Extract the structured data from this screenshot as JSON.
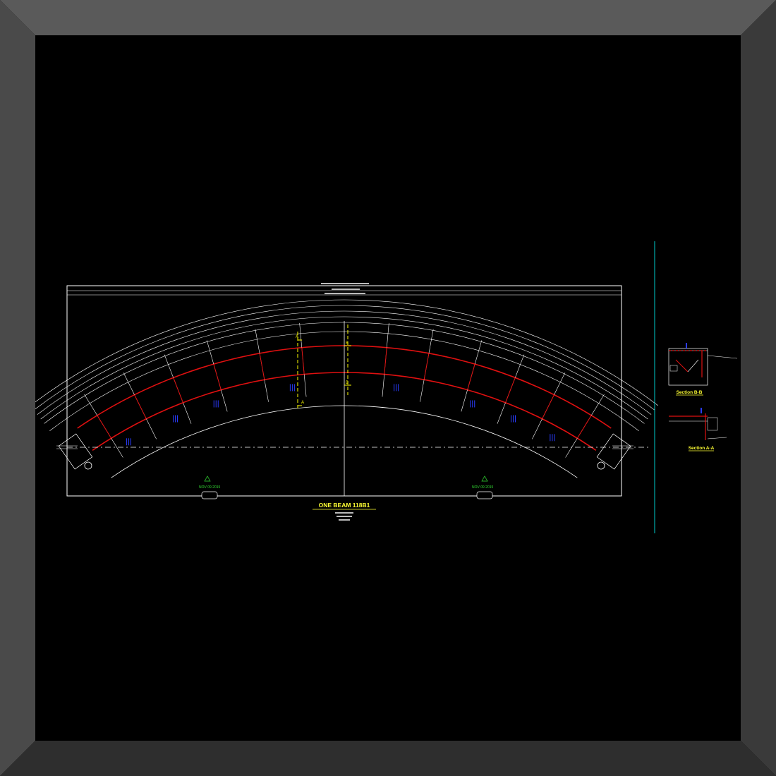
{
  "drawing": {
    "title": "ONE BEAM 118B1",
    "section_b": {
      "title": "Section B-B"
    },
    "section_a": {
      "title": "Section A-A"
    },
    "cut_marks": {
      "a": "A",
      "b": "B"
    },
    "revision_markers": [
      {
        "symbol": "1",
        "note": "NOV 09 2015"
      },
      {
        "symbol": "1",
        "note": "NOV 09 2015"
      }
    ]
  },
  "colors": {
    "background": "#000000",
    "frame_outer": "#5a5a5a",
    "frame_inner": "#2e2e2e",
    "linework": "#ffffff",
    "beam_flange": "#e01010",
    "cut_lines": "#ffff00",
    "stiffeners": "#2a3cff",
    "annotation_green": "#33dd33",
    "title_yellow": "#ffff33",
    "sheet_divider": "#00cccc"
  },
  "icons": {
    "revision": "revision-triangle-icon",
    "cut_arrow": "section-cut-arrow-icon"
  }
}
